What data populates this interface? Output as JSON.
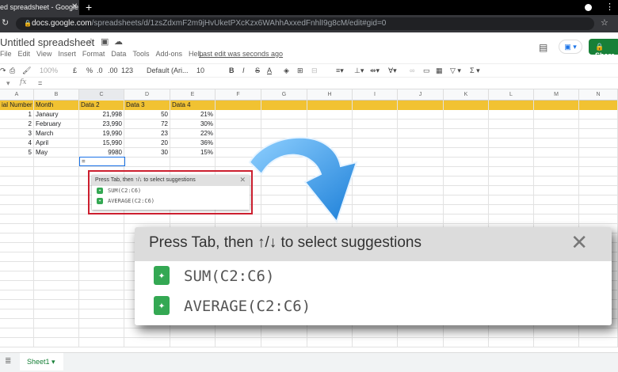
{
  "browser": {
    "tab_title": "ed spreadsheet - Google Sh",
    "url_host": "docs.google.com",
    "url_path": "/spreadsheets/d/1zsZdxmF2m9jHvUketPXcKzx6WAhhAxxedFnhlI9g8cM/edit#gid=0"
  },
  "doc": {
    "title": "Untitled spreadsheet",
    "last_edit": "Last edit was seconds ago",
    "share_label": "Share"
  },
  "menu": [
    "File",
    "Edit",
    "View",
    "Insert",
    "Format",
    "Data",
    "Tools",
    "Add-ons",
    "Help"
  ],
  "toolbar": {
    "zoom": "100%",
    "currency": "£",
    "percent": "%",
    "dec_less": ".0",
    "dec_more": ".00",
    "format": "123",
    "font": "Default (Ari...",
    "font_size": "10"
  },
  "formula": {
    "fx": "fx",
    "value": "="
  },
  "columns": [
    "A",
    "B",
    "C",
    "D",
    "E",
    "F",
    "G",
    "H",
    "I",
    "J",
    "K",
    "L",
    "M",
    "N"
  ],
  "table": {
    "headers": [
      "ial Number",
      "Month",
      "Data 2",
      "Data 3",
      "Data 4"
    ],
    "rows": [
      [
        "1",
        "Janaury",
        "21,998",
        "50",
        "21%"
      ],
      [
        "2",
        "February",
        "23,990",
        "72",
        "30%"
      ],
      [
        "3",
        "March",
        "19,990",
        "23",
        "22%"
      ],
      [
        "4",
        "April",
        "15,990",
        "20",
        "36%"
      ],
      [
        "5",
        "May",
        "9980",
        "30",
        "15%"
      ]
    ]
  },
  "active_cell": {
    "value": "="
  },
  "suggestions": {
    "hint": "Press Tab, then ↑/↓ to select suggestions",
    "items": [
      "SUM(C2:C6)",
      "AVERAGE(C2:C6)"
    ]
  },
  "sheets": [
    "Sheet1"
  ],
  "colors": {
    "header_fill": "#f1c232",
    "accent": "#1a73e8",
    "share": "#188038",
    "highlight_border": "#cc1f2f",
    "arrow": "#3da0f0"
  }
}
